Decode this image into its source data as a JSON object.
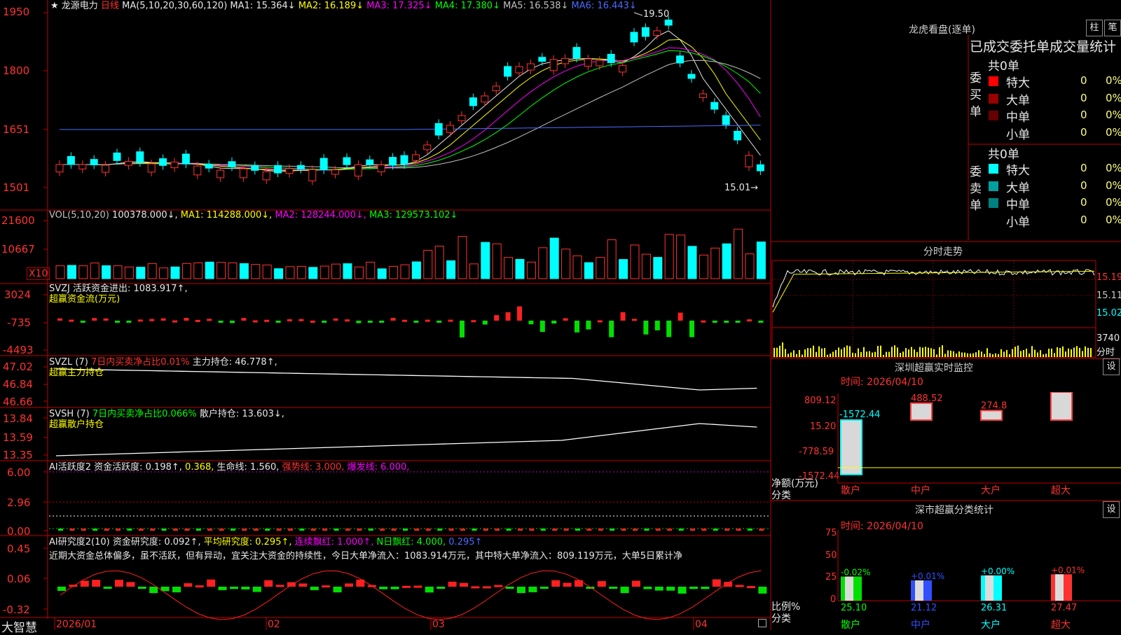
{
  "stock": {
    "star": "★",
    "name": "龙源电力",
    "period": "日线",
    "ma_label": "MA(5,10,20,30,60,120)",
    "ma_values": [
      {
        "label": "MA1: 15.364↓",
        "color": "#e8e8e8"
      },
      {
        "label": "MA2: 16.189↓",
        "color": "#ffff00"
      },
      {
        "label": "MA3: 17.325↓",
        "color": "#ff00ff"
      },
      {
        "label": "MA4: 17.380↓",
        "color": "#00ff00"
      },
      {
        "label": "MA5: 16.538↓",
        "color": "#c0c0c0"
      },
      {
        "label": "MA6: 16.443↓",
        "color": "#4a6cff"
      }
    ],
    "high_mark": "19.50",
    "low_mark": "15.01→",
    "price_axis": [
      "1950",
      "1800",
      "1651",
      "1501"
    ]
  },
  "volume": {
    "label": "VOL(5,10,20)",
    "value": "100378.000↓,",
    "ma1": "MA1: 114288.000↓,",
    "ma2": "MA2: 128244.000↓,",
    "ma3": "MA3: 129573.102↓",
    "axis": [
      "21600",
      "10667"
    ],
    "unit": "X10"
  },
  "svzj": {
    "label": "SVZJ  活跃资金进出: 1083.917↑,",
    "sub": "超赢资金流(万元)",
    "axis": [
      "3024",
      "-735",
      "-4493"
    ]
  },
  "svzl": {
    "label": "SVZL (7)",
    "ratio": "7日内买卖净占比0.01%",
    "hold": "主力持仓: 46.778↑,",
    "sub": "超赢主力持仓",
    "axis": [
      "47.02",
      "46.84",
      "46.66"
    ]
  },
  "svsh": {
    "label": "SVSH (7)",
    "ratio": "7日内买卖净占比0.066%",
    "hold": "散户持仓: 13.603↓,",
    "sub": "超赢散户持仓",
    "axis": [
      "13.84",
      "13.59",
      "13.35"
    ]
  },
  "ai_active": {
    "label": "AI活跃度2",
    "p1": "资金活跃度: 0.198↑,",
    "p2": "0.368,",
    "p3": "生命线: 1.560,",
    "p4": "强势线: 3.000,",
    "p5": "爆发线: 6.000,",
    "axis": [
      "6.00",
      "2.96",
      "0.00"
    ]
  },
  "ai_research": {
    "label": "AI研究度2(10)",
    "p1": "资金研究度: 0.092↑,",
    "p2": "平均研究度: 0.295↑,",
    "p3": "连续飘红: 1.000↑,",
    "p4": "N日飘红: 4.000,",
    "p5": "0.295↑",
    "comment": "近期大资金总体偏多，虽不活跃，但有异动，宜关注大资金的持续性，今日大单净流入：1083.914万元，其中特大单净流入：809.119万元，大单5日累计净",
    "axis": [
      "0.45",
      "0.06",
      "-0.32"
    ]
  },
  "xaxis": {
    "brand": "大智慧",
    "dates": [
      "2026/01",
      "02",
      "03",
      "04"
    ]
  },
  "longhu": {
    "title": "龙虎看盘(逐单)",
    "btn_zhu": "柱",
    "btn_bi": "笔",
    "stats_title": "已成交委托单成交量统计",
    "buy": {
      "group": "委买单",
      "total": "共0单",
      "rows": [
        {
          "name": "特大",
          "count": "0",
          "pct": "0%",
          "color": "#ff0000"
        },
        {
          "name": "大单",
          "count": "0",
          "pct": "0%",
          "color": "#990000"
        },
        {
          "name": "中单",
          "count": "0",
          "pct": "0%",
          "color": "#660000"
        },
        {
          "name": "小单",
          "count": "0",
          "pct": "0%",
          "color": "#000000"
        }
      ]
    },
    "sell": {
      "group": "委卖单",
      "total": "共0单",
      "rows": [
        {
          "name": "特大",
          "count": "0",
          "pct": "0%",
          "color": "#00ffff"
        },
        {
          "name": "大单",
          "count": "0",
          "pct": "0%",
          "color": "#00a0a0"
        },
        {
          "name": "中单",
          "count": "0",
          "pct": "0%",
          "color": "#008080"
        },
        {
          "name": "小单",
          "count": "0",
          "pct": "0%",
          "color": "#000000"
        }
      ]
    }
  },
  "intraday": {
    "title": "分时走势",
    "axis": [
      "15.19",
      "15.11",
      "15.02"
    ],
    "vol_label": "3740",
    "vol_unit": "分时"
  },
  "sz_monitor": {
    "title": "深圳超赢实时监控",
    "settings": "设",
    "time": "时间: 2026/04/10",
    "axis": [
      "809.12",
      "15.20",
      "-778.59",
      "-1572.44"
    ],
    "axis_caption": "净额(万元)",
    "x_caption": "分类",
    "categories": [
      "散户",
      "中户",
      "大户",
      "超大"
    ],
    "values": [
      -1572.44,
      488.52,
      274.8,
      809.12
    ],
    "value_labels": [
      "-1572.44",
      "488.52",
      "274.8",
      "809.12"
    ]
  },
  "sz_classify": {
    "title": "深市超赢分类统计",
    "settings": "设",
    "time": "时间: 2026/04/10",
    "axis": [
      "75",
      "50",
      "25",
      "0"
    ],
    "y_caption": "比例%",
    "x_caption": "分类",
    "categories": [
      "散户",
      "中户",
      "大户",
      "超大"
    ],
    "values": [
      25.1,
      21.12,
      26.31,
      27.47
    ],
    "value_labels": [
      "25.10",
      "21.12",
      "26.31",
      "27.47"
    ],
    "changes": [
      "-0.02%",
      "+0.01%",
      "+0.00%",
      "+0.01%"
    ]
  }
}
